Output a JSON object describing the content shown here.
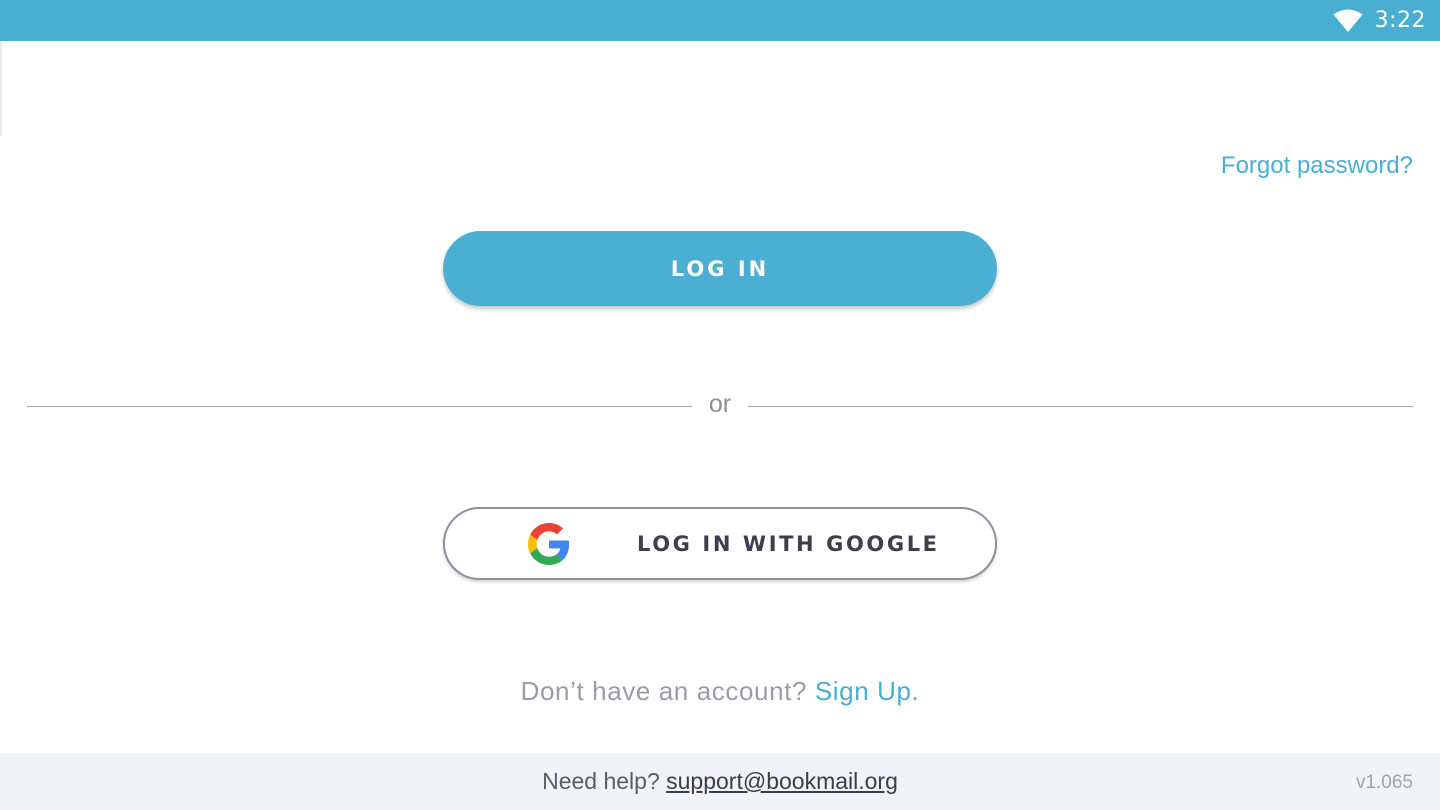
{
  "status_bar": {
    "time": "3:22",
    "icons": [
      "wifi-icon"
    ],
    "background": "#48afd2"
  },
  "login": {
    "forgot_password": "Forgot password?",
    "login_button": "LOG IN",
    "divider": "or",
    "google_button": "LOG IN WITH GOOGLE",
    "google_icon": "google-icon",
    "signup_prompt": "Don’t have an account?",
    "signup_link": "Sign Up."
  },
  "footer": {
    "help_prompt": "Need help?",
    "support_email": "support@bookmail.org",
    "version": "v1.065"
  },
  "colors": {
    "accent": "#48afd2",
    "footer_background": "#f2f3f7",
    "muted_text": "#9a9ca8"
  }
}
